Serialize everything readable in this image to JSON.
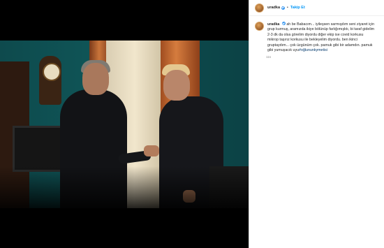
{
  "post": {
    "username": "uradka",
    "follow_label": "Takip Et",
    "separator": "•",
    "caption_lines": [
      "ah be Babacım... iyileşsen sarmışdım seni ziyaret için",
      "grup kurmuş, aramızda ikiye bölünüp farlığımışktı, bi taraf gidelim",
      "2-3 dk da olsa görelim diyordu diğer ekip ise covid korkusu",
      "mikrop taşırız korkusu ile bekleyelim diyordu. ben ikinci",
      "gruptaydım... çok üzgünüm çok. pamuk gibi bir adamdın. pamuk",
      "gibi yumuşacık uyu"
    ],
    "hashtag": "#oğlununkymetisi",
    "time": "11s"
  },
  "icons": {
    "avatar": "profile-avatar",
    "verified": "verified-badge-icon"
  },
  "colors": {
    "accent": "#0095f6",
    "hashtag": "#00376b",
    "verified": "#3897f0"
  }
}
